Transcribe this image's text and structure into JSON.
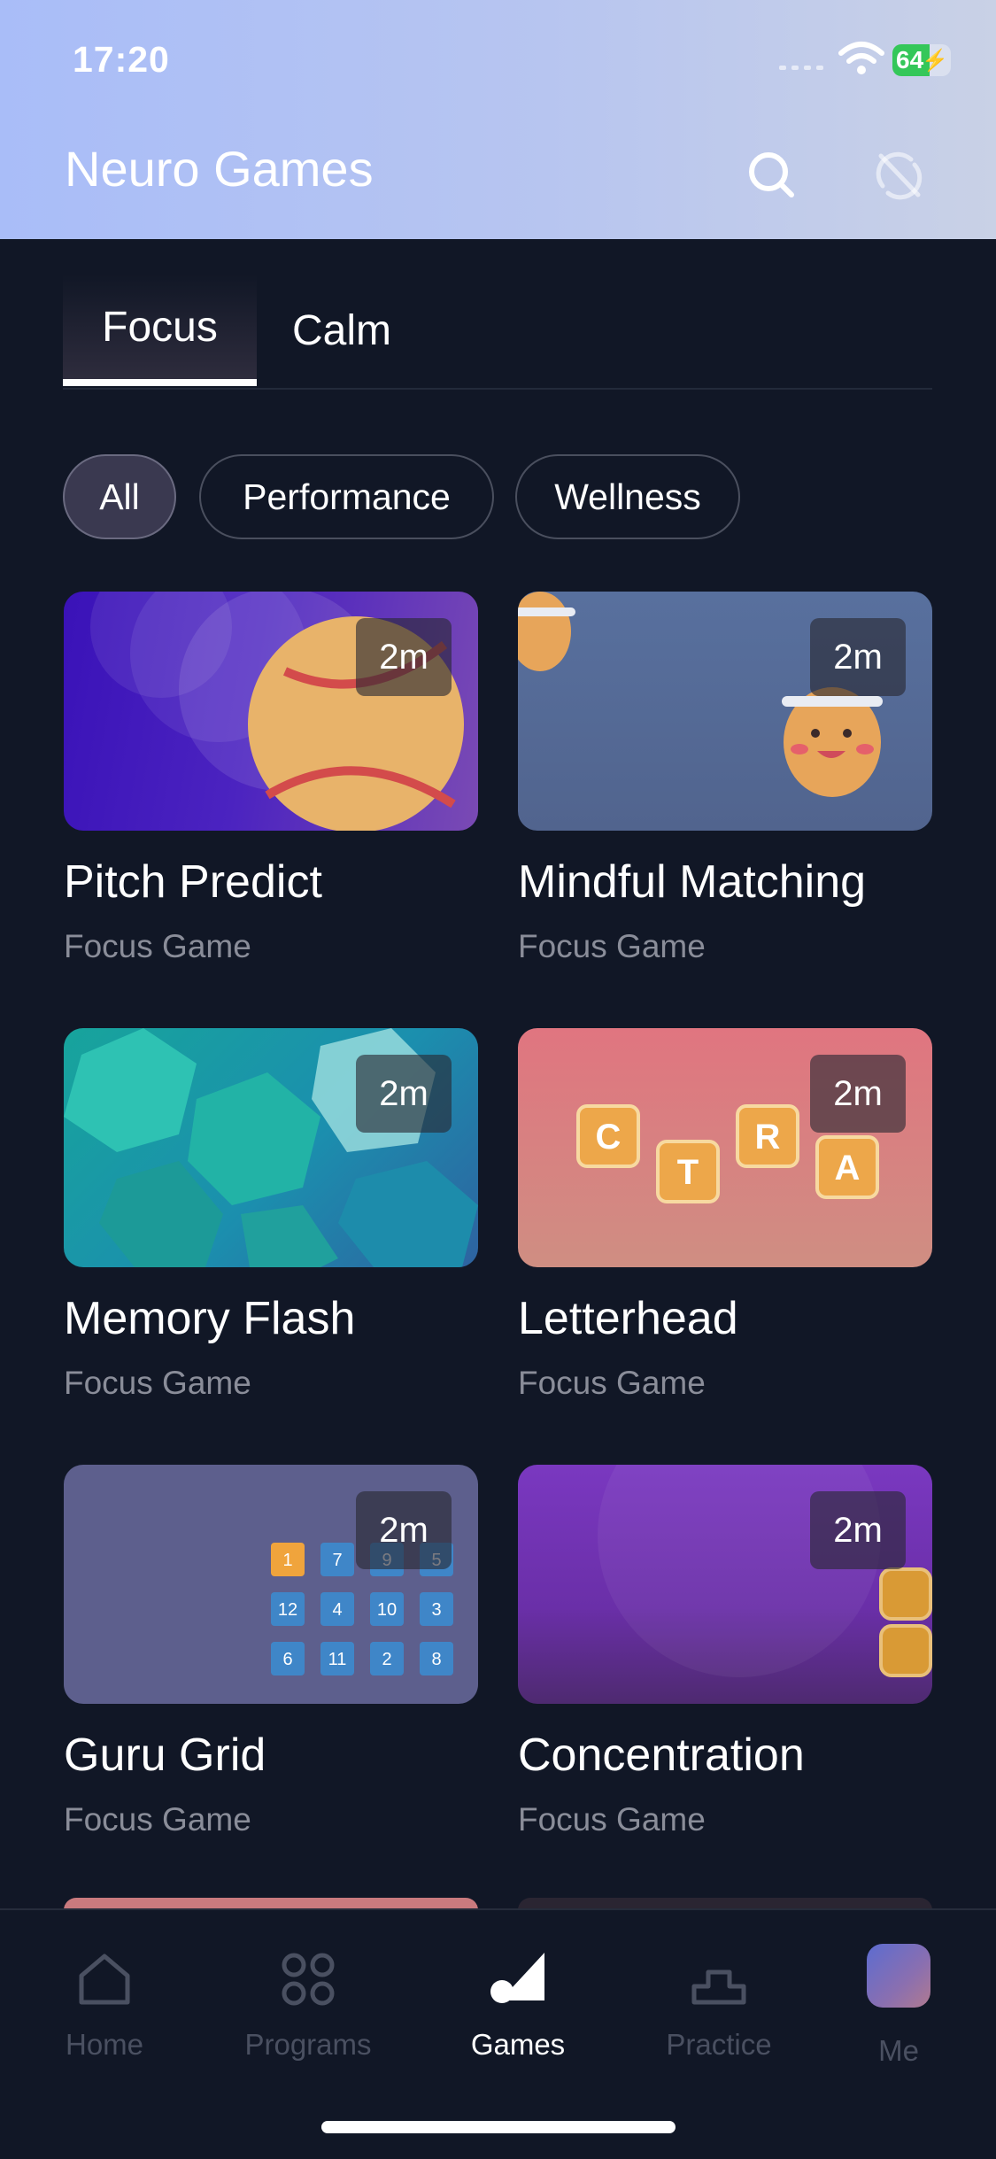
{
  "status_bar": {
    "time": "17:20",
    "battery_percent": 64,
    "battery_label": "64",
    "charging": true,
    "icons": [
      "signal-icon",
      "wifi-icon",
      "battery-icon"
    ]
  },
  "header": {
    "title": "Neuro Games",
    "icons": [
      "search-icon",
      "sync-off-icon"
    ]
  },
  "tabs": [
    {
      "label": "Focus",
      "selected": true
    },
    {
      "label": "Calm",
      "selected": false
    }
  ],
  "filters": [
    {
      "label": "All",
      "selected": true
    },
    {
      "label": "Performance",
      "selected": false
    },
    {
      "label": "Wellness",
      "selected": false
    }
  ],
  "games": [
    {
      "title": "Pitch Predict",
      "category": "Focus Game",
      "duration": "2m"
    },
    {
      "title": "Mindful Matching",
      "category": "Focus Game",
      "duration": "2m"
    },
    {
      "title": "Memory Flash",
      "category": "Focus Game",
      "duration": "2m"
    },
    {
      "title": "Letterhead",
      "category": "Focus Game",
      "duration": "2m"
    },
    {
      "title": "Guru Grid",
      "category": "Focus Game",
      "duration": "2m"
    },
    {
      "title": "Concentration",
      "category": "Focus Game",
      "duration": "2m"
    }
  ],
  "letterhead_tiles": [
    "C",
    "T",
    "R",
    "A"
  ],
  "guru_grid_numbers": [
    "1",
    "7",
    "9",
    "5",
    "12",
    "4",
    "10",
    "3",
    "6",
    "11",
    "2",
    "8"
  ],
  "bottom_nav": [
    {
      "label": "Home",
      "icon": "home-icon",
      "active": false
    },
    {
      "label": "Programs",
      "icon": "programs-icon",
      "active": false
    },
    {
      "label": "Games",
      "icon": "games-icon",
      "active": true
    },
    {
      "label": "Practice",
      "icon": "practice-icon",
      "active": false
    },
    {
      "label": "Me",
      "icon": "avatar-icon",
      "active": false
    }
  ],
  "colors": {
    "background": "#111726",
    "header_gradient_start": "#a9bdf8",
    "header_gradient_end": "#c9d1e6",
    "subtitle": "#8a8d99",
    "nav_inactive": "#4a5061",
    "battery_green": "#34c759"
  }
}
